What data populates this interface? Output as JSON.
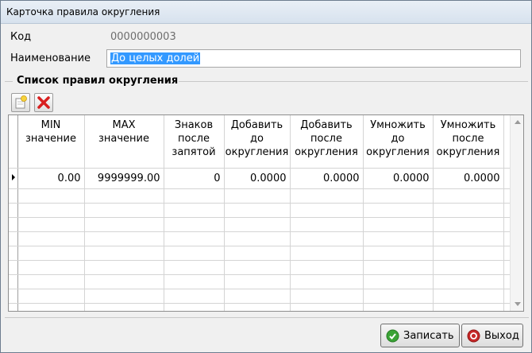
{
  "window": {
    "title": "Карточка правила округления"
  },
  "fields": {
    "code_label": "Код",
    "code_value": "0000000003",
    "name_label": "Наименование",
    "name_value": "До целых долей"
  },
  "group": {
    "title": "Список правил округления"
  },
  "toolbar": {
    "add_icon": "add-row-icon",
    "delete_icon": "delete-row-icon"
  },
  "table": {
    "columns": [
      {
        "line1": "MIN",
        "line2": "значение",
        "line3": "",
        "line4": ""
      },
      {
        "line1": "MAX",
        "line2": "значение",
        "line3": "",
        "line4": ""
      },
      {
        "line1": "Знаков",
        "line2": "после",
        "line3": "запятой",
        "line4": ""
      },
      {
        "line1": "Добавить",
        "line2": "до",
        "line3": "округления",
        "line4": ""
      },
      {
        "line1": "Добавить",
        "line2": "после",
        "line3": "округления",
        "line4": ""
      },
      {
        "line1": "Умножить",
        "line2": "до",
        "line3": "округления",
        "line4": ""
      },
      {
        "line1": "Умножить",
        "line2": "после",
        "line3": "округления",
        "line4": ""
      }
    ],
    "rows": [
      {
        "min": "0.00",
        "max": "9999999.00",
        "decimals": "0",
        "add_before": "0.0000",
        "add_after": "0.0000",
        "mul_before": "0.0000",
        "mul_after": "0.0000"
      }
    ]
  },
  "buttons": {
    "save_label": "Записать",
    "exit_label": "Выход"
  },
  "colors": {
    "selection": "#3399ff",
    "delete_red": "#d81e1e",
    "save_green": "#3aa335",
    "exit_red": "#c62828"
  }
}
